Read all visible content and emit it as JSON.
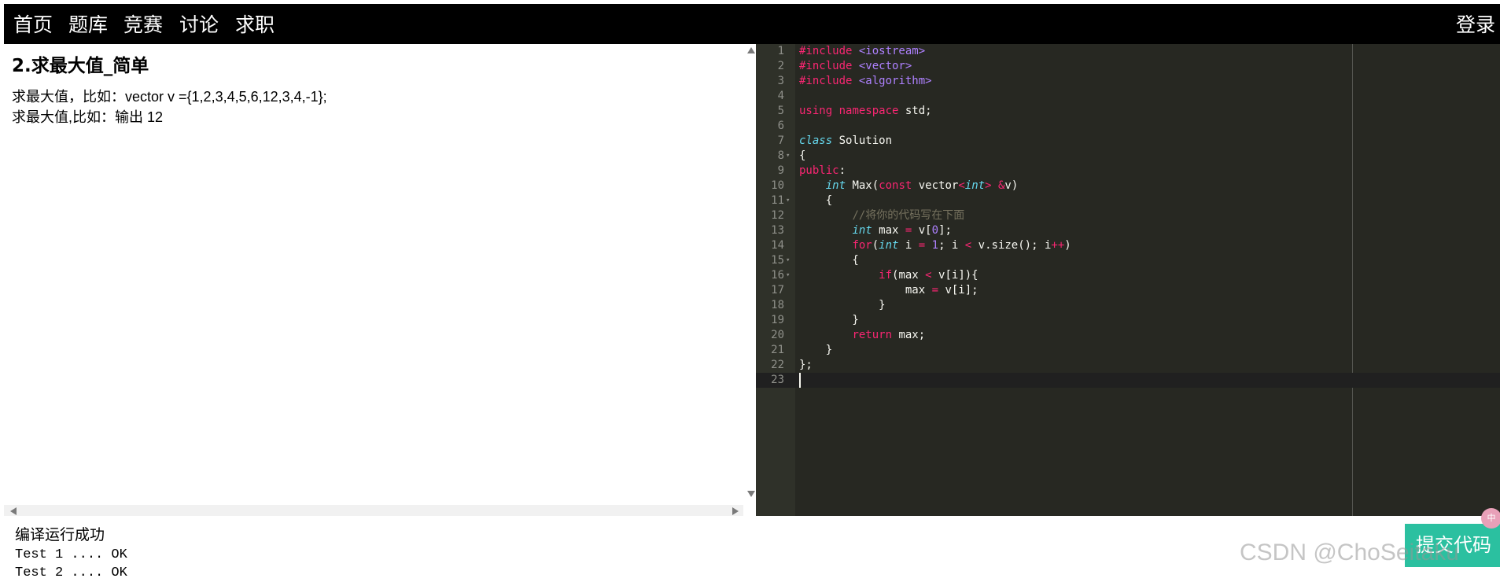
{
  "nav": {
    "items": [
      "首页",
      "题库",
      "竞赛",
      "讨论",
      "求职"
    ],
    "login": "登录"
  },
  "problem": {
    "title": "2.求最大值_简单",
    "desc_line1": "求最大值，比如：vector v ={1,2,3,4,5,6,12,3,4,-1};",
    "desc_line2": "求最大值,比如：输出 12"
  },
  "editor": {
    "theme_colors": {
      "background": "#272822",
      "keyword": "#f92672",
      "type": "#66d9ef",
      "string": "#ae81ff",
      "comment": "#75715e",
      "text": "#f8f8f2"
    },
    "active_line": 23,
    "lines": [
      "#include <iostream>",
      "#include <vector>",
      "#include <algorithm>",
      "",
      "using namespace std;",
      "",
      "class Solution",
      "{",
      "public:",
      "    int Max(const vector<int> &v)",
      "    {",
      "        //将你的代码写在下面",
      "        int max = v[0];",
      "        for(int i = 1; i < v.size(); i++)",
      "        {",
      "            if(max < v[i]){",
      "                max = v[i];",
      "            }",
      "        }",
      "        return max;",
      "    }",
      "};",
      ""
    ]
  },
  "result": {
    "title": "编译运行成功",
    "lines": [
      "Test 1 .... OK",
      "Test 2 .... OK"
    ]
  },
  "submit_label": "提交代码",
  "badge_label": "中",
  "watermark": "CSDN @ChoSeitaku"
}
